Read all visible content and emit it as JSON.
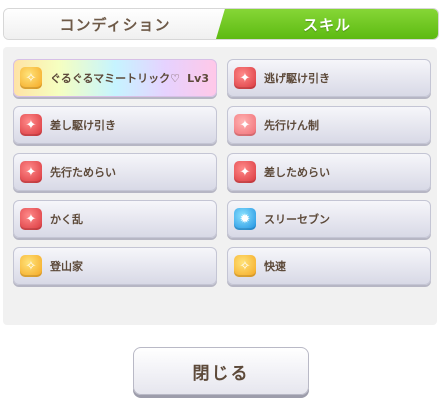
{
  "tabs": [
    {
      "label": "コンディション",
      "active": false
    },
    {
      "label": "スキル",
      "active": true
    }
  ],
  "skills": [
    {
      "name": "ぐるぐるマミートリック♡",
      "level": "Lv3",
      "icon": "unique-skill-icon",
      "style": "rainbow",
      "color": "gold"
    },
    {
      "name": "逃げ駆け引き",
      "icon": "debuff-skill-icon",
      "color": "red"
    },
    {
      "name": "差し駆け引き",
      "icon": "debuff-skill-icon",
      "color": "red"
    },
    {
      "name": "先行けん制",
      "icon": "debuff-skill-icon",
      "color": "pink"
    },
    {
      "name": "先行ためらい",
      "icon": "debuff-skill-icon",
      "color": "red"
    },
    {
      "name": "差しためらい",
      "icon": "debuff-skill-icon",
      "color": "red"
    },
    {
      "name": "かく乱",
      "icon": "debuff-skill-icon",
      "color": "red"
    },
    {
      "name": "スリーセブン",
      "icon": "recovery-skill-icon",
      "color": "blue"
    },
    {
      "name": "登山家",
      "icon": "speed-skill-icon",
      "color": "gold"
    },
    {
      "name": "快速",
      "icon": "speed-skill-icon",
      "color": "gold"
    }
  ],
  "close_button": {
    "label": "閉じる"
  },
  "colors": {
    "active_tab": "#6ac51e",
    "text": "#5d4a3a",
    "panel_bg": "#f1f1f1"
  }
}
